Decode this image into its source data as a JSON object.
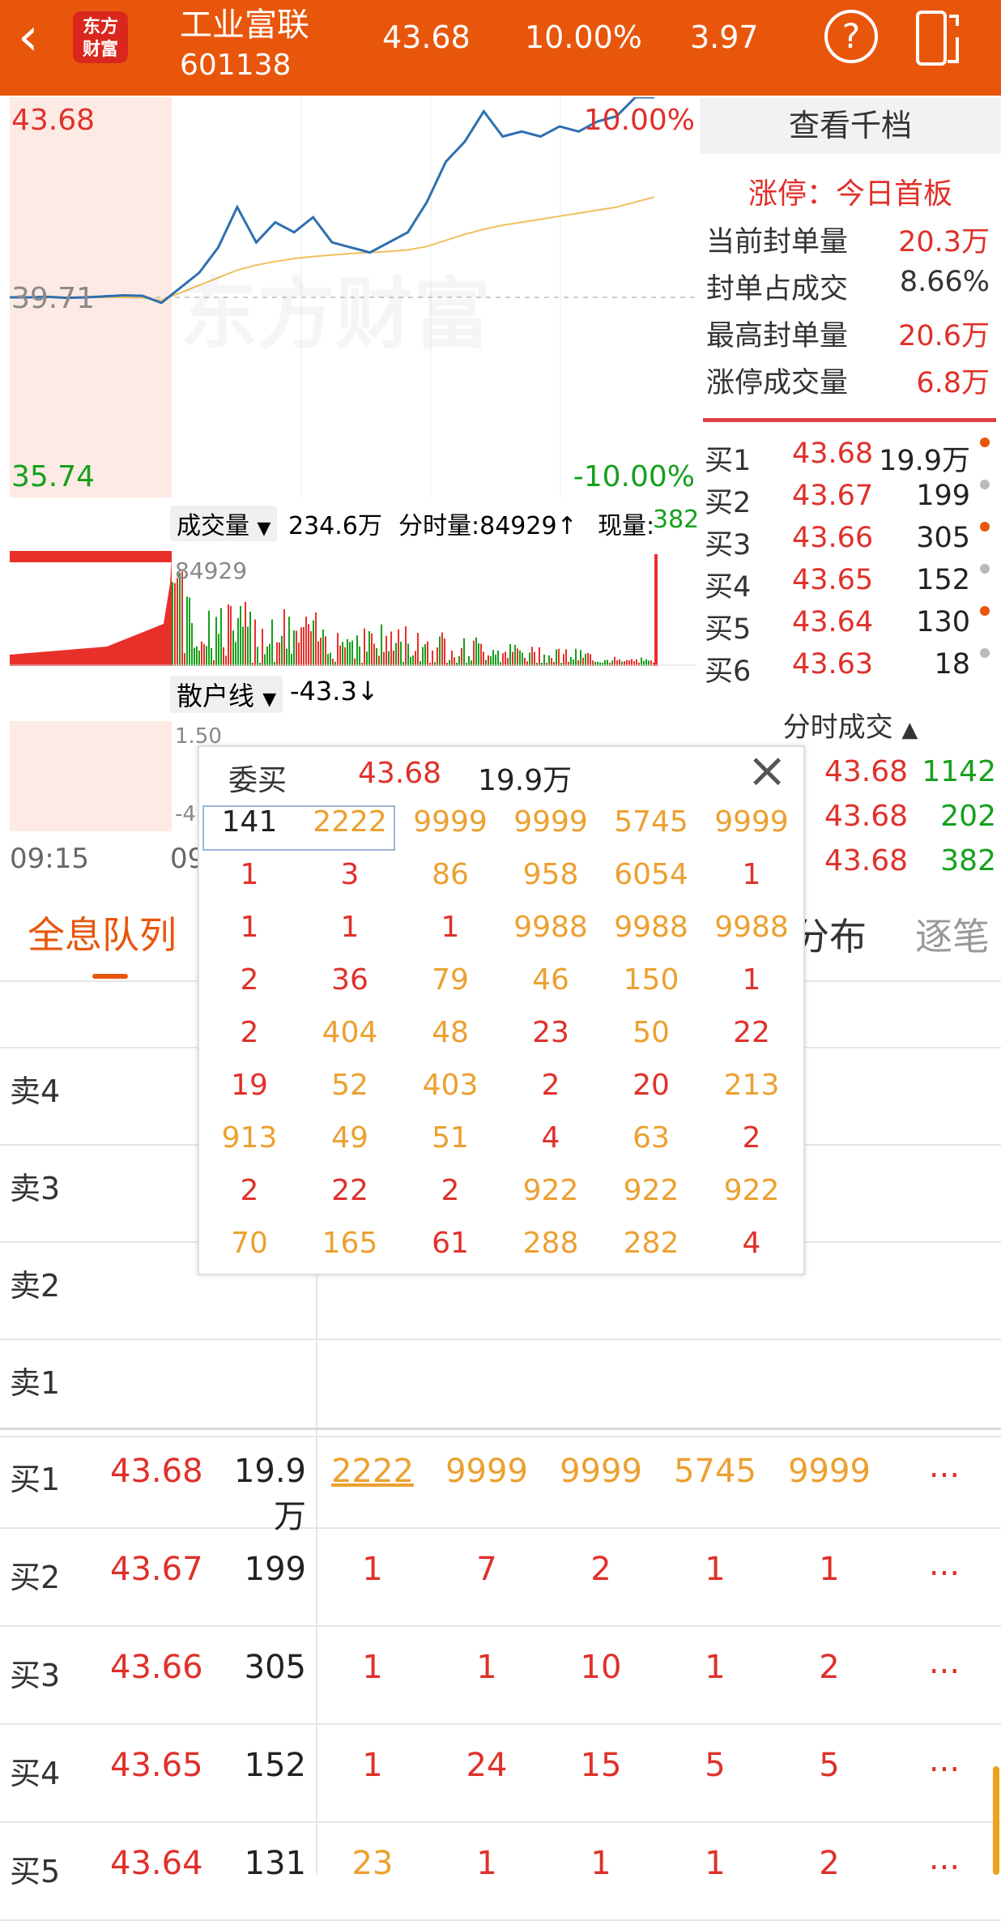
{
  "header": {
    "back_icon": "‹",
    "logo_line1": "东方",
    "logo_line2": "财富",
    "stock_name": "工业富联",
    "stock_code": "601138",
    "price": "43.68",
    "change_pct": "10.00%",
    "change": "3.97",
    "help_icon": "?",
    "colors": {
      "bar": "#e8560c",
      "up": "#e0302a",
      "down": "#15a01c",
      "queue": "#eca030"
    }
  },
  "chart": {
    "high_label": "43.68",
    "pct_high": "10.00%",
    "pre_close": "39.71",
    "low_label": "35.74",
    "pct_low": "-10.00%",
    "watermark": "东方财富",
    "y_range": [
      35.74,
      43.68
    ],
    "price_series": [
      39.71,
      39.71,
      39.72,
      39.7,
      39.71,
      39.73,
      39.75,
      39.74,
      39.6,
      39.9,
      40.2,
      40.7,
      41.5,
      40.8,
      41.2,
      41.0,
      41.3,
      40.8,
      40.7,
      40.6,
      40.8,
      41.0,
      41.6,
      42.4,
      42.8,
      43.4,
      42.9,
      43.0,
      42.9,
      43.1,
      43.0,
      43.2,
      43.3,
      43.68,
      43.68
    ],
    "avg_series": [
      39.71,
      39.71,
      39.71,
      39.71,
      39.71,
      39.71,
      39.71,
      39.7,
      39.65,
      39.8,
      39.95,
      40.1,
      40.25,
      40.35,
      40.42,
      40.48,
      40.52,
      40.55,
      40.58,
      40.6,
      40.62,
      40.65,
      40.72,
      40.84,
      40.96,
      41.06,
      41.14,
      41.2,
      41.26,
      41.32,
      41.38,
      41.44,
      41.5,
      41.6,
      41.7
    ],
    "volume_label": "成交量",
    "volume_total": "234.6万",
    "volume_min": "分时量:84929↑",
    "volume_now_label": "现量:",
    "volume_now": "382",
    "volume_max": "84929",
    "retail_label": "散户线",
    "retail_value": "-43.3↓",
    "retail_tick_1": "1.50",
    "retail_tick_2": "-4",
    "time_start": "09:15",
    "time_2": "09"
  },
  "orderbook": {
    "title": "查看千档",
    "limit_label": "涨停：今日首板",
    "seal_rows": [
      {
        "label": "当前封单量",
        "value": "20.3万"
      },
      {
        "label": "封单占成交",
        "value": "8.66%"
      },
      {
        "label": "最高封单量",
        "value": "20.6万"
      },
      {
        "label": "涨停成交量",
        "value": "6.8万"
      }
    ],
    "bids": [
      {
        "label": "买1",
        "price": "43.68",
        "vol": "19.9万",
        "dot": "#e8560c"
      },
      {
        "label": "买2",
        "price": "43.67",
        "vol": "199",
        "dot": "#bbbbbb"
      },
      {
        "label": "买3",
        "price": "43.66",
        "vol": "305",
        "dot": "#e8560c"
      },
      {
        "label": "买4",
        "price": "43.65",
        "vol": "152",
        "dot": "#bbbbbb"
      },
      {
        "label": "买5",
        "price": "43.64",
        "vol": "130",
        "dot": "#e8560c"
      },
      {
        "label": "买6",
        "price": "43.63",
        "vol": "18",
        "dot": "#bbbbbb"
      }
    ],
    "trades_title": "分时成交",
    "trades": [
      {
        "price": "43.68",
        "vol": "1142"
      },
      {
        "price": "43.68",
        "vol": "202"
      },
      {
        "price": "43.68",
        "vol": "382"
      }
    ]
  },
  "popup": {
    "title": "委买",
    "price": "43.68",
    "vol": "19.9万",
    "close_icon": "×",
    "rows": [
      [
        "141",
        "2222",
        "9999",
        "9999",
        "5745",
        "9999"
      ],
      [
        "1",
        "3",
        "86",
        "958",
        "6054",
        "1"
      ],
      [
        "1",
        "1",
        "1",
        "9988",
        "9988",
        "9988"
      ],
      [
        "2",
        "36",
        "79",
        "46",
        "150",
        "1"
      ],
      [
        "2",
        "404",
        "48",
        "23",
        "50",
        "22"
      ],
      [
        "19",
        "52",
        "403",
        "2",
        "20",
        "213"
      ],
      [
        "913",
        "49",
        "51",
        "4",
        "63",
        "2"
      ],
      [
        "2",
        "22",
        "2",
        "922",
        "922",
        "922"
      ],
      [
        "70",
        "165",
        "61",
        "288",
        "282",
        "4"
      ]
    ],
    "colors": [
      [
        "k",
        "o",
        "o",
        "o",
        "o",
        "o"
      ],
      [
        "r",
        "r",
        "o",
        "o",
        "o",
        "r"
      ],
      [
        "r",
        "r",
        "r",
        "o",
        "o",
        "o"
      ],
      [
        "r",
        "r",
        "o",
        "o",
        "o",
        "r"
      ],
      [
        "r",
        "o",
        "o",
        "r",
        "o",
        "r"
      ],
      [
        "r",
        "o",
        "o",
        "r",
        "r",
        "o"
      ],
      [
        "o",
        "o",
        "o",
        "r",
        "o",
        "r"
      ],
      [
        "r",
        "r",
        "r",
        "o",
        "o",
        "o"
      ],
      [
        "o",
        "o",
        "r",
        "o",
        "o",
        "r"
      ]
    ]
  },
  "tabs": {
    "active": "全息队列",
    "t2": "分布",
    "t3": "逐笔"
  },
  "queue": {
    "asks": [
      "卖4",
      "卖3",
      "卖2",
      "卖1"
    ],
    "bids": [
      {
        "label": "买1",
        "price": "43.68",
        "vol": "19.9万",
        "cells": [
          "2222",
          "9999",
          "9999",
          "5745",
          "9999"
        ],
        "colors": [
          "o",
          "o",
          "o",
          "o",
          "o"
        ]
      },
      {
        "label": "买2",
        "price": "43.67",
        "vol": "199",
        "cells": [
          "1",
          "7",
          "2",
          "1",
          "1"
        ],
        "colors": [
          "r",
          "r",
          "r",
          "r",
          "r"
        ]
      },
      {
        "label": "买3",
        "price": "43.66",
        "vol": "305",
        "cells": [
          "1",
          "1",
          "10",
          "1",
          "2"
        ],
        "colors": [
          "r",
          "r",
          "r",
          "r",
          "r"
        ]
      },
      {
        "label": "买4",
        "price": "43.65",
        "vol": "152",
        "cells": [
          "1",
          "24",
          "15",
          "5",
          "5"
        ],
        "colors": [
          "r",
          "r",
          "r",
          "r",
          "r"
        ]
      },
      {
        "label": "买5",
        "price": "43.64",
        "vol": "131",
        "cells": [
          "23",
          "1",
          "1",
          "1",
          "2"
        ],
        "colors": [
          "o",
          "r",
          "r",
          "r",
          "r"
        ]
      }
    ],
    "more": "..."
  }
}
